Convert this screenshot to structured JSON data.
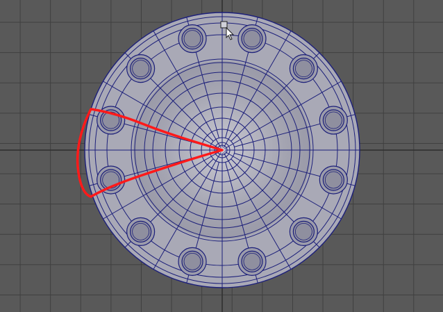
{
  "viewport": {
    "name": "3d-modeling-viewport",
    "view": "top-orthographic",
    "grid": true
  },
  "colors": {
    "background": "#595959",
    "grid": "#3f3f3f",
    "grid_axis": "#2e2e2e",
    "mesh_fill": "#a9a9b6",
    "wireframe": "#1c1f7a",
    "annotation": "#ff1a1a",
    "cursor": "#ffffff"
  },
  "model": {
    "type": "flange",
    "bolt_hole_count": 12,
    "radial_segments": 24,
    "ring_count": 10
  },
  "annotation": {
    "shape": "wedge-selection",
    "highlighted_segments": 2
  },
  "cursor": {
    "icon": "move-cursor-icon"
  }
}
